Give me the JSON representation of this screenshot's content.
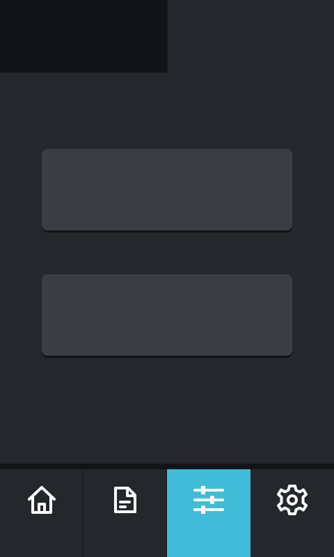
{
  "colors": {
    "background": "#24272c",
    "card": "#3a3d44",
    "active_top_tab": "#131417",
    "active_nav": "#41bcd8",
    "icon": "#ffffff"
  },
  "top_tabs": [
    {
      "label": "",
      "active": true
    },
    {
      "label": "",
      "active": false
    }
  ],
  "content": {
    "buttons": [
      {
        "label": ""
      },
      {
        "label": ""
      }
    ]
  },
  "bottom_nav": {
    "items": [
      {
        "icon": "home-icon",
        "active": false
      },
      {
        "icon": "document-icon",
        "active": false
      },
      {
        "icon": "sliders-icon",
        "active": true
      },
      {
        "icon": "gear-icon",
        "active": false
      }
    ]
  }
}
